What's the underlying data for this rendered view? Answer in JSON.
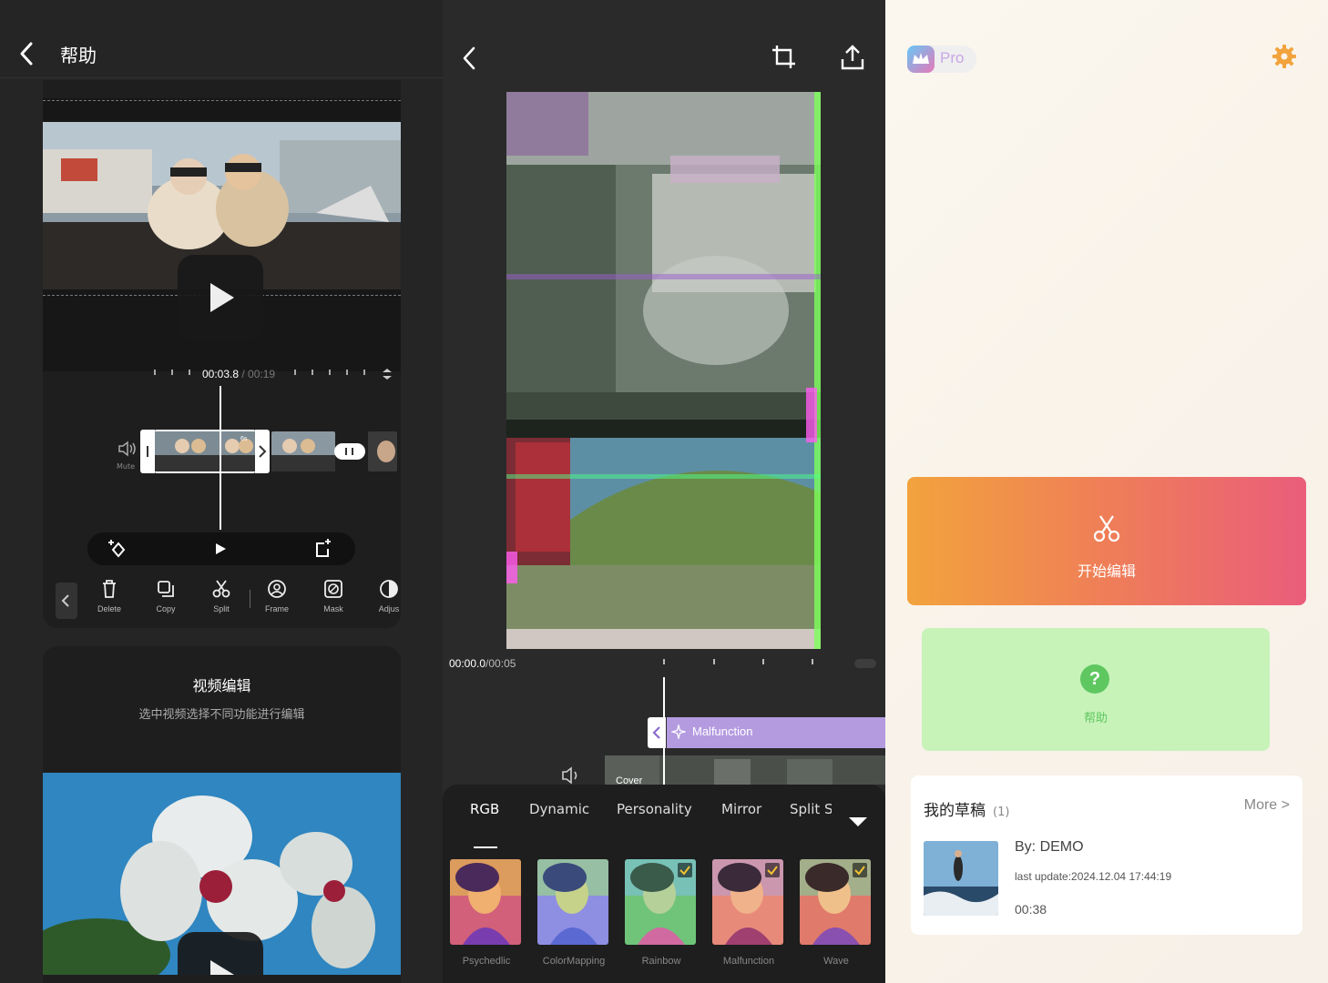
{
  "help_panel": {
    "title": "帮助",
    "timeline": {
      "current": "00:03.8",
      "total": "/ 00:19"
    },
    "mute_label": "Mute",
    "clip_duration": "6s",
    "tools": [
      {
        "label": "Delete",
        "icon": "trash-icon"
      },
      {
        "label": "Copy",
        "icon": "copy-icon"
      },
      {
        "label": "Split",
        "icon": "scissors-icon"
      },
      {
        "label": "Frame",
        "icon": "frame-icon"
      },
      {
        "label": "Mask",
        "icon": "mask-icon"
      },
      {
        "label": "Adjus",
        "icon": "adjust-icon"
      }
    ],
    "card2": {
      "title": "视频编辑",
      "subtitle": "选中视频选择不同功能进行编辑"
    }
  },
  "editor_panel": {
    "time": {
      "current": "00:00.0",
      "total": "/00:05"
    },
    "effect_name": "Malfunction",
    "cover_label": "Cover",
    "tabs": [
      "RGB",
      "Dynamic",
      "Personality",
      "Mirror",
      "Split S"
    ],
    "active_tab": "RGB",
    "filters": [
      {
        "name": "Psychedlic",
        "checked": false,
        "tint": "#e86a7a"
      },
      {
        "name": "ColorMapping",
        "checked": false,
        "tint": "#8fa6e0"
      },
      {
        "name": "Rainbow",
        "checked": true,
        "tint": "#7fd48e"
      },
      {
        "name": "Malfunction",
        "checked": true,
        "tint": "#e58a9a"
      },
      {
        "name": "Wave",
        "checked": true,
        "tint": "#d8ae8c"
      }
    ]
  },
  "home_panel": {
    "pro_label": "Pro",
    "start_edit_label": "开始编辑",
    "help_label": "帮助",
    "drafts": {
      "title": "我的草稿",
      "count": "(1)",
      "more": "More >",
      "item": {
        "by": "By: DEMO",
        "updated": "last update:2024.12.04 17:44:19",
        "duration": "00:38"
      }
    },
    "colors": {
      "start_from": "#f2a33d",
      "start_to": "#ea5d7b",
      "help_bg": "#c7f3b9",
      "help_accent": "#5fc760"
    }
  }
}
